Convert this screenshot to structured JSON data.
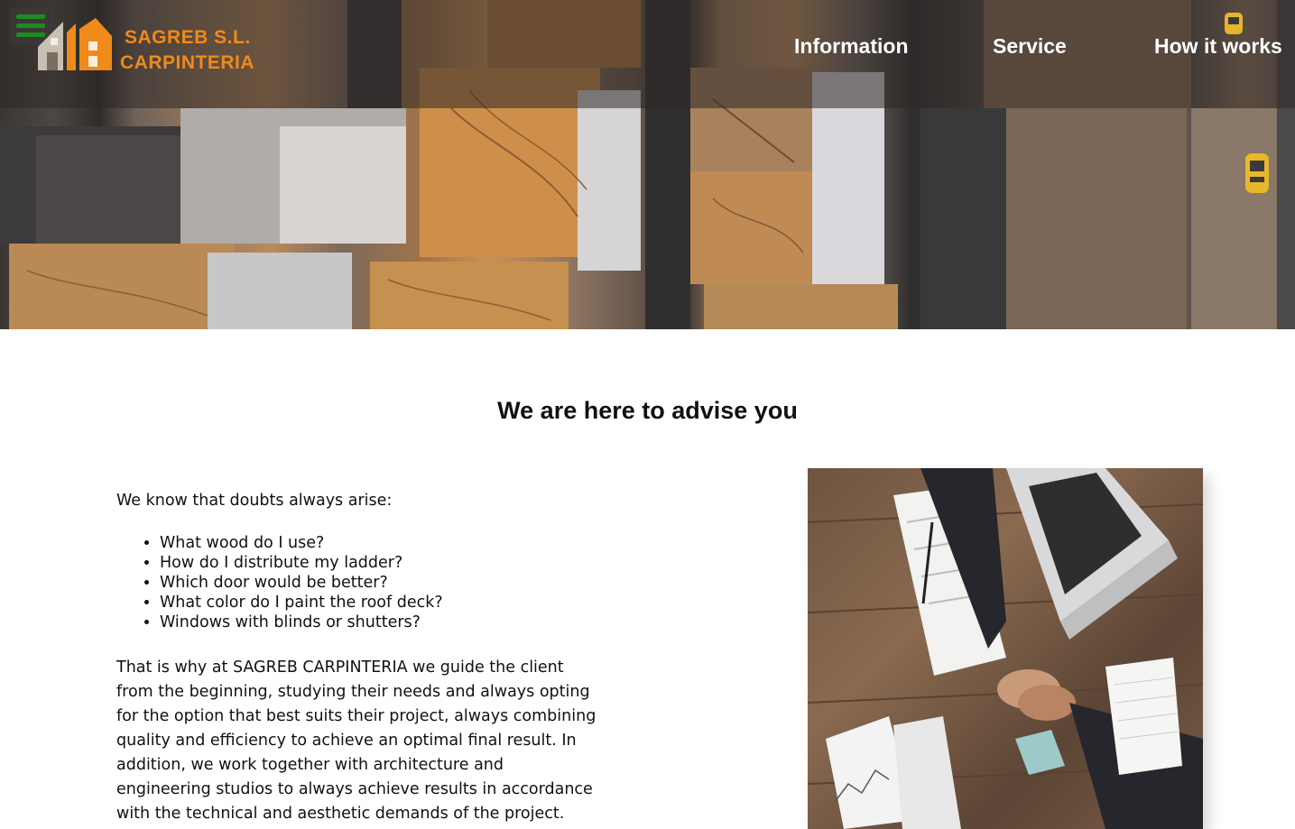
{
  "header": {
    "brand_line1": "SAGREB S.L.",
    "brand_line2": "CARPINTERIA",
    "brand_color": "#f08a1a",
    "menu_icon": "hamburger-menu-icon",
    "menu_icon_color": "#1f8a1f",
    "nav": [
      {
        "label": "Information"
      },
      {
        "label": "Service"
      },
      {
        "label": "How it works"
      }
    ]
  },
  "main": {
    "title": "We are here to advise you",
    "intro": "We know that doubts always arise:",
    "questions": [
      "What wood do I use?",
      "How do I distribute my ladder?",
      "Which door would be better?",
      "What color do I paint the roof deck?",
      "Windows with blinds or shutters?"
    ],
    "body": "That is why at SAGREB CARPINTERIA we guide the client from the beginning, studying their needs and always opting for the option that best suits their project, always combining quality and efficiency to achieve an optimal final result. In addition, we work together with architecture and engineering studios to always achieve results in accordance with the technical and aesthetic demands of the project."
  }
}
